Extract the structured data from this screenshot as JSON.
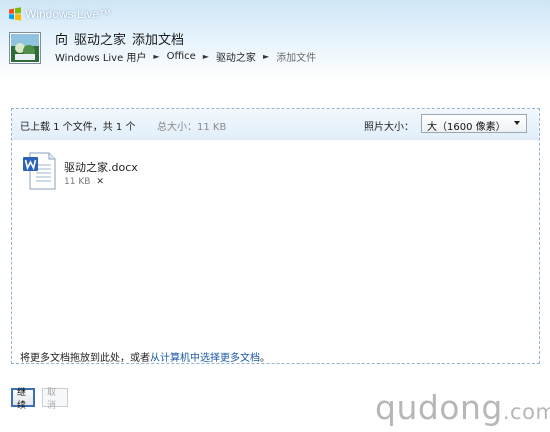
{
  "brand": {
    "name": "Windows Live™"
  },
  "header": {
    "prefix": "向",
    "folder": "驱动之家",
    "action": "添加文档"
  },
  "breadcrumb": [
    {
      "label": "Windows Live 用户"
    },
    {
      "label": "Office"
    },
    {
      "label": "驱动之家"
    },
    {
      "label": "添加文件"
    }
  ],
  "panel": {
    "uploaded_text": "已上载 1 个文件，共 1 个",
    "total_size": "总大小：11 KB",
    "photo_size_label": "照片大小：",
    "photo_size_value": "大（1600 像素）",
    "files": [
      {
        "name": "驱动之家.docx",
        "size": "11 KB",
        "remove": "✕"
      }
    ],
    "drop_hint_prefix": "将更多文档拖放到此处，或者",
    "drop_hint_link": "从计算机中选择更多文档",
    "drop_hint_suffix": "。"
  },
  "buttons": {
    "continue": "继续",
    "cancel": "取消"
  },
  "watermark": {
    "main": "qudong",
    "suffix": ".com"
  }
}
